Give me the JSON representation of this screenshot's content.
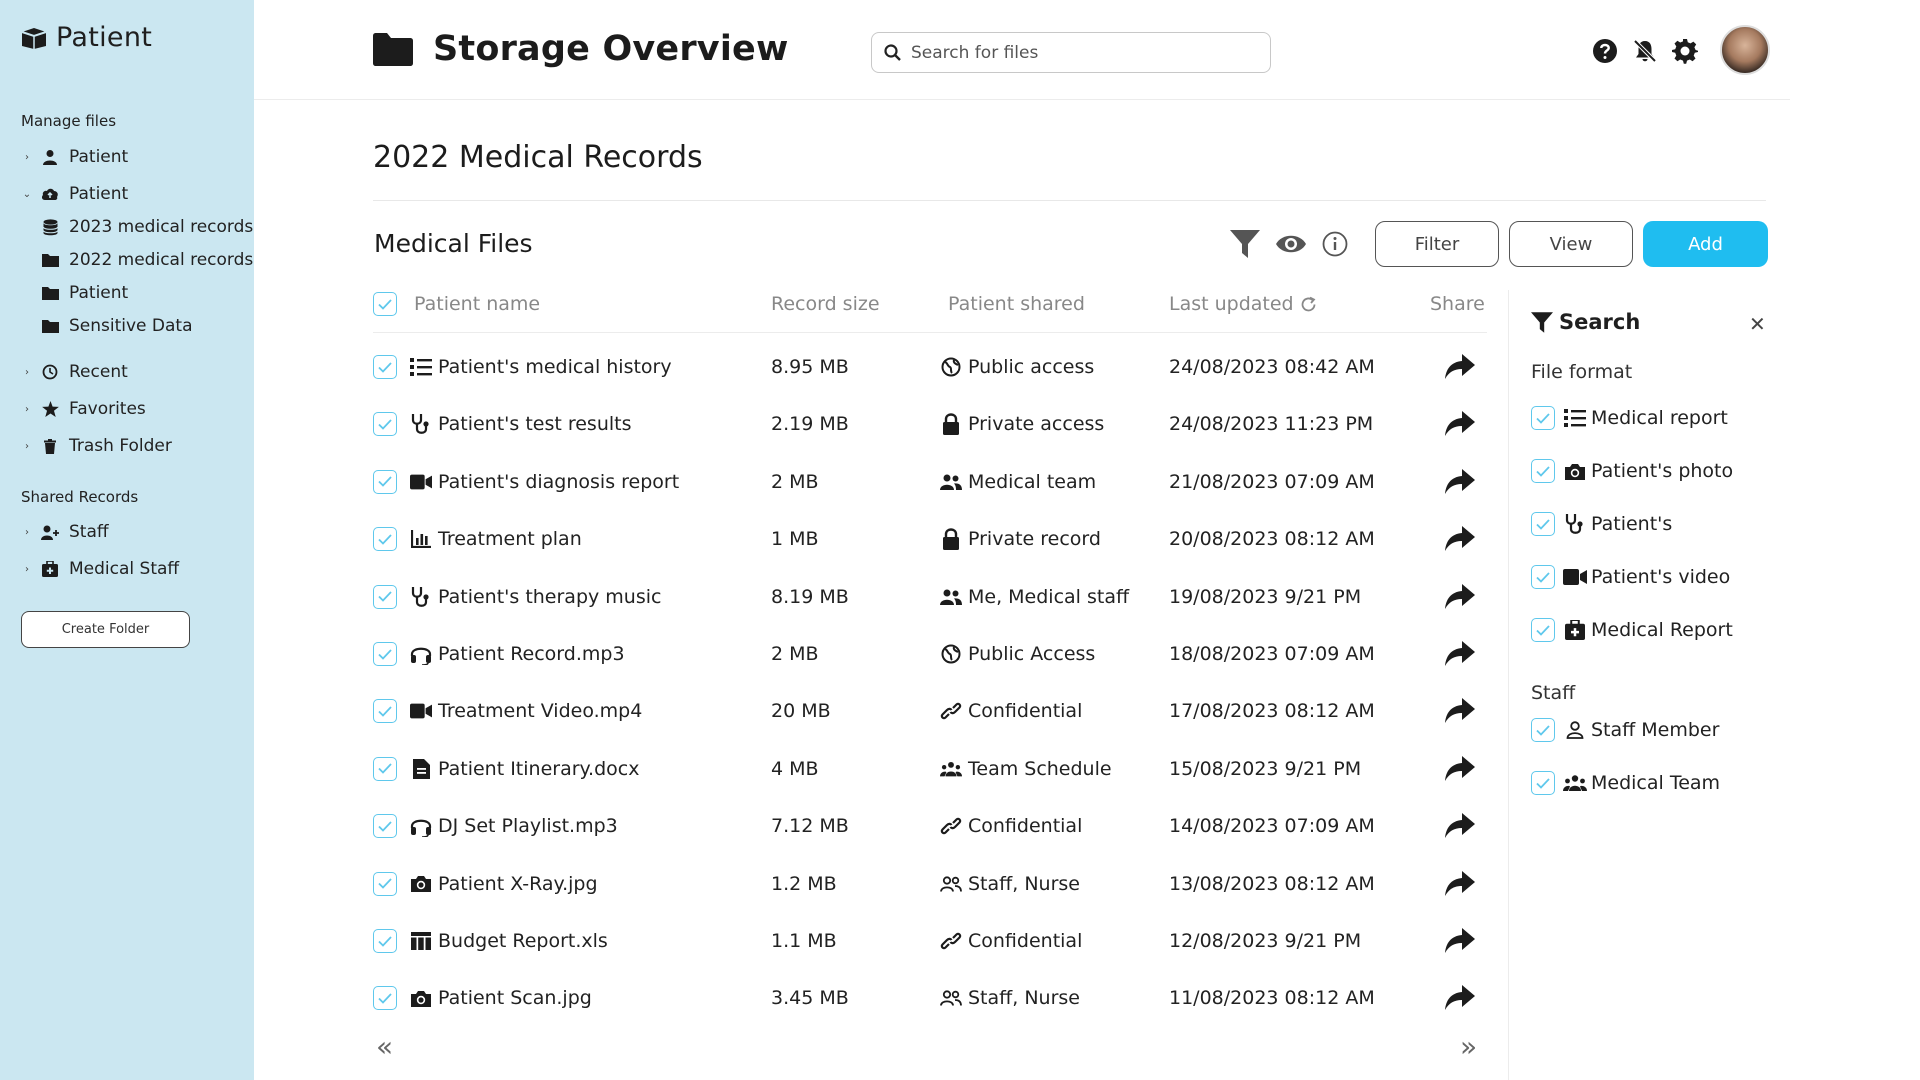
{
  "sidebar": {
    "brand": "Patient",
    "sections": {
      "manage": "Manage files",
      "shared": "Shared Records"
    },
    "items": [
      {
        "label": "Patient",
        "icon": "user-icon"
      },
      {
        "label": "Patient",
        "icon": "cloud-icon",
        "expanded": true
      },
      {
        "label": "2023 medical records",
        "icon": "database-icon"
      },
      {
        "label": "2022 medical records",
        "icon": "folder-icon"
      },
      {
        "label": "Patient",
        "icon": "folder-icon"
      },
      {
        "label": "Sensitive Data",
        "icon": "folder-icon"
      },
      {
        "label": "Recent",
        "icon": "clock-icon"
      },
      {
        "label": "Favorites",
        "icon": "star-icon"
      },
      {
        "label": "Trash Folder",
        "icon": "trash-icon"
      },
      {
        "label": "Staff",
        "icon": "user-plus-icon"
      },
      {
        "label": "Medical Staff",
        "icon": "medical-bag-icon"
      }
    ],
    "create_folder": "Create Folder"
  },
  "header": {
    "title": "Storage Overview",
    "search_placeholder": "Search for files"
  },
  "main": {
    "heading": "2022 Medical Records",
    "files_title": "Medical Files",
    "buttons": {
      "filter": "Filter",
      "view": "View",
      "add": "Add"
    }
  },
  "table": {
    "columns": {
      "name": "Patient name",
      "size": "Record size",
      "shared": "Patient shared",
      "updated": "Last updated",
      "share": "Share"
    },
    "rows": [
      {
        "name": "Patient's medical history",
        "icon": "list-icon",
        "size": "8.95 MB",
        "shared": "Public access",
        "shared_icon": "globe-icon",
        "updated": "24/08/2023 08:42 AM"
      },
      {
        "name": "Patient's test results",
        "icon": "stethoscope-icon",
        "size": "2.19 MB",
        "shared": "Private access",
        "shared_icon": "lock-icon",
        "updated": "24/08/2023 11:23 PM"
      },
      {
        "name": "Patient's diagnosis report",
        "icon": "video-icon",
        "size": "2 MB",
        "shared": "Medical team",
        "shared_icon": "users-icon",
        "updated": "21/08/2023 07:09 AM"
      },
      {
        "name": "Treatment plan",
        "icon": "bar-chart-icon",
        "size": "1 MB",
        "shared": "Private record",
        "shared_icon": "lock-icon",
        "updated": "20/08/2023 08:12 AM"
      },
      {
        "name": "Patient's therapy music",
        "icon": "stethoscope-icon",
        "size": "8.19 MB",
        "shared": "Me, Medical staff",
        "shared_icon": "users-icon",
        "updated": "19/08/2023 9/21 PM"
      },
      {
        "name": "Patient Record.mp3",
        "icon": "headset-icon",
        "size": "2 MB",
        "shared": "Public Access",
        "shared_icon": "globe-icon",
        "updated": "18/08/2023 07:09 AM"
      },
      {
        "name": "Treatment Video.mp4",
        "icon": "video-icon",
        "size": "20 MB",
        "shared": "Confidential",
        "shared_icon": "link-icon",
        "updated": "17/08/2023 08:12 AM"
      },
      {
        "name": "Patient Itinerary.docx",
        "icon": "document-icon",
        "size": "4 MB",
        "shared": "Team Schedule",
        "shared_icon": "team-icon",
        "updated": "15/08/2023 9/21 PM"
      },
      {
        "name": "DJ Set Playlist.mp3",
        "icon": "headset-icon",
        "size": "7.12 MB",
        "shared": "Confidential",
        "shared_icon": "link-icon",
        "updated": "14/08/2023 07:09 AM"
      },
      {
        "name": "Patient X-Ray.jpg",
        "icon": "camera-icon",
        "size": "1.2 MB",
        "shared": "Staff, Nurse",
        "shared_icon": "user-group-outline-icon",
        "updated": "13/08/2023 08:12 AM"
      },
      {
        "name": "Budget Report.xls",
        "icon": "table-icon",
        "size": "1.1 MB",
        "shared": "Confidential",
        "shared_icon": "link-icon",
        "updated": "12/08/2023 9/21 PM"
      },
      {
        "name": "Patient Scan.jpg",
        "icon": "camera-icon",
        "size": "3.45 MB",
        "shared": "Staff, Nurse",
        "shared_icon": "user-group-outline-icon",
        "updated": "11/08/2023 08:12 AM"
      }
    ],
    "pager": {
      "prev": "«",
      "next": "»"
    }
  },
  "panel": {
    "title": "Search",
    "groups": {
      "format": "File format",
      "staff": "Staff"
    },
    "format_items": [
      {
        "label": "Medical report",
        "icon": "list-icon"
      },
      {
        "label": "Patient's photo",
        "icon": "camera-icon"
      },
      {
        "label": "Patient's",
        "icon": "stethoscope-icon"
      },
      {
        "label": "Patient's video",
        "icon": "video-icon"
      },
      {
        "label": "Medical Report",
        "icon": "medical-bag-icon"
      }
    ],
    "staff_items": [
      {
        "label": "Staff Member",
        "icon": "user-outline-icon"
      },
      {
        "label": "Medical Team",
        "icon": "team-icon"
      }
    ]
  },
  "colors": {
    "sidebar_bg": "#cbe7f1",
    "accent": "#1fbdf0",
    "checkbox": "#5fc8ec"
  }
}
